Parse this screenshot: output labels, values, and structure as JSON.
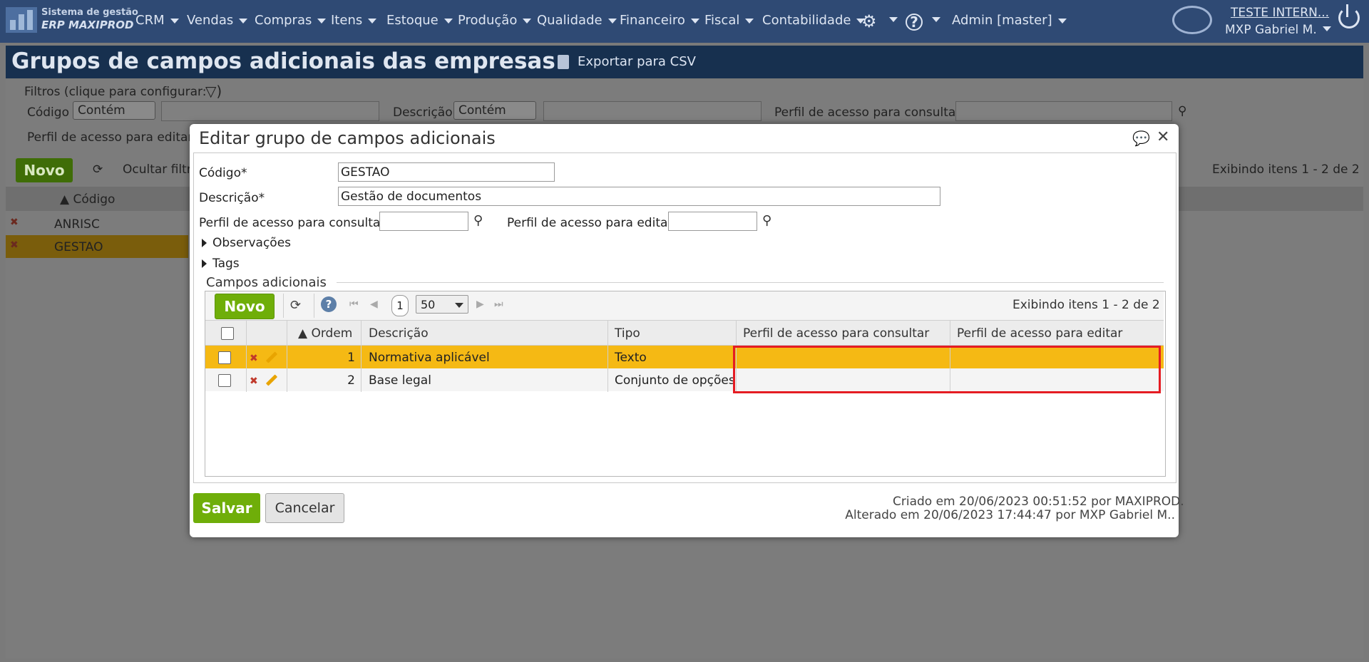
{
  "nav": {
    "logo_line1": "Sistema de gestão",
    "logo_line2": "ERP MAXIPROD",
    "menus": [
      "CRM",
      "Vendas",
      "Compras",
      "Itens",
      "Estoque",
      "Produção",
      "Qualidade",
      "Financeiro",
      "Fiscal",
      "Contabilidade"
    ],
    "admin": "Admin [master]",
    "user_link": "TESTE INTERN...",
    "user_name": "MXP Gabriel M."
  },
  "page": {
    "title": "Grupos de campos adicionais das empresas",
    "export_label": "Exportar para CSV"
  },
  "background": {
    "filters_label": "Filtros (clique para configurar:",
    "filter_codigo_label": "Código",
    "filter_codigo_op": "Contém",
    "filter_descricao_label": "Descrição",
    "filter_descricao_op": "Contém",
    "filter_perfil_consultar": "Perfil de acesso para consultar",
    "filter_perfil_editar": "Perfil de acesso para editar",
    "novo": "Novo",
    "ocultar": "Ocultar filtr",
    "exibindo": "Exibindo itens 1 - 2 de 2",
    "col_codigo": "Código",
    "rows": [
      "ANRISC",
      "GESTAO"
    ]
  },
  "modal": {
    "title": "Editar grupo de campos adicionais",
    "codigo_label": "Código*",
    "codigo_value": "GESTAO",
    "descricao_label": "Descrição*",
    "descricao_value": "Gestão de documentos",
    "perfil_consultar_label": "Perfil de acesso para consultar",
    "perfil_editar_label": "Perfil de acesso para editar",
    "observacoes": "Observações",
    "tags": "Tags",
    "section_title": "Campos adicionais",
    "grid": {
      "novo": "Novo",
      "page": "1",
      "page_size": "50",
      "info": "Exibindo itens 1 - 2 de 2",
      "headers": {
        "ordem": "Ordem",
        "descricao": "Descrição",
        "tipo": "Tipo",
        "perfil_consultar": "Perfil de acesso para consultar",
        "perfil_editar": "Perfil de acesso para editar"
      },
      "rows": [
        {
          "ordem": "1",
          "descricao": "Normativa aplicável",
          "tipo": "Texto",
          "perfil_consultar": "",
          "perfil_editar": ""
        },
        {
          "ordem": "2",
          "descricao": "Base legal",
          "tipo": "Conjunto de opções",
          "perfil_consultar": "",
          "perfil_editar": ""
        }
      ]
    },
    "salvar": "Salvar",
    "cancelar": "Cancelar",
    "created": "Criado em 20/06/2023 00:51:52 por MAXIPROD.",
    "altered": "Alterado em 20/06/2023 17:44:47 por MXP Gabriel M.."
  },
  "colors": {
    "nav_bg": "#2f4a74",
    "header_bg": "#17304f",
    "accent_green": "#6fae09",
    "row_selected": "#f5b914",
    "highlight_red": "#e51c23"
  }
}
